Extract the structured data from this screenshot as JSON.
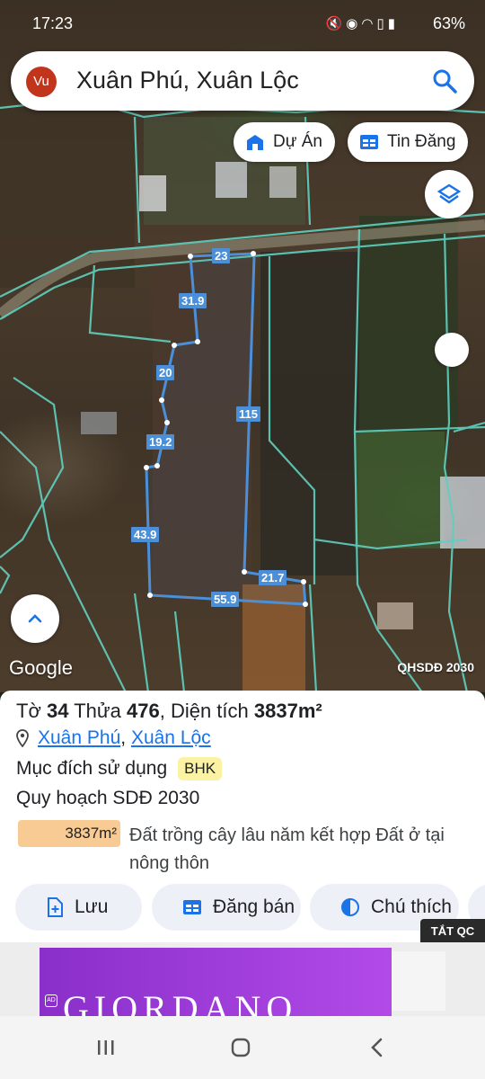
{
  "status_bar": {
    "time": "17:23",
    "battery": "63%",
    "icons": [
      "mute-icon",
      "location-icon",
      "wifi-icon",
      "volte-icon",
      "signal-icon",
      "battery-icon"
    ]
  },
  "search": {
    "avatar_initials": "Vu",
    "query": "Xuân Phú, Xuân Lộc"
  },
  "map_buttons": {
    "du_an": "Dự Án",
    "tin_dang": "Tin Đăng"
  },
  "map_overlay": {
    "edge_labels": [
      "23",
      "31.9",
      "20",
      "19.2",
      "43.9",
      "115",
      "21.7",
      "55.9"
    ],
    "google_logo": "Google",
    "plan_label": "QHSDĐ 2030"
  },
  "parcel": {
    "to_label": "Tờ",
    "to_value": "34",
    "thua_label": "Thửa",
    "thua_value": "476",
    "dien_tich_label": "Diện tích",
    "dien_tich_value": "3837m²",
    "location_ward": "Xuân Phú",
    "location_sep": ",",
    "location_district": "Xuân Lộc",
    "purpose_label": "Mục đích sử dụng",
    "purpose_code": "BHK",
    "plan_title": "Quy hoạch SDĐ 2030",
    "plan_area": "3837m²",
    "plan_description": "Đất trồng cây lâu năm kết hợp Đất ở tại nông thôn",
    "plan_color": "#f8cb95"
  },
  "actions": {
    "save": "Lưu",
    "post_sale": "Đăng bán",
    "legend": "Chú thích"
  },
  "ad": {
    "close_label": "TẮT QC",
    "brand_text": "GIORDANO",
    "ad_icon": "AD"
  },
  "colors": {
    "accent": "#1a73e8",
    "parcel_outline": "#4a8fd8",
    "boundary": "#5fd0c0"
  }
}
